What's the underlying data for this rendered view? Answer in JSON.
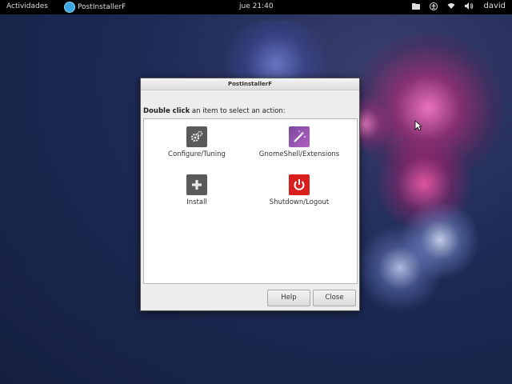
{
  "topbar": {
    "activities": "Actividades",
    "app_name": "PostInstallerF",
    "clock": "jue 21:40",
    "user": "david",
    "icons": [
      "folder-icon",
      "accessibility-icon",
      "wifi-icon",
      "volume-icon"
    ]
  },
  "dialog": {
    "title": "PostInstallerF",
    "instruction_bold": "Double click",
    "instruction_rest": " an item to select an action:",
    "items": [
      {
        "label": "Configure/Tuning",
        "icon": "gear-icon"
      },
      {
        "label": "GnomeShell/Extensions",
        "icon": "magic-wand-icon"
      },
      {
        "label": "Install",
        "icon": "plus-icon"
      },
      {
        "label": "Shutdown/Logout",
        "icon": "power-icon"
      }
    ],
    "help_label": "Help",
    "close_label": "Close"
  },
  "colors": {
    "power_red": "#d91e1e",
    "wand_purple": "#9a55b5",
    "topbar_bg": "#000000"
  }
}
